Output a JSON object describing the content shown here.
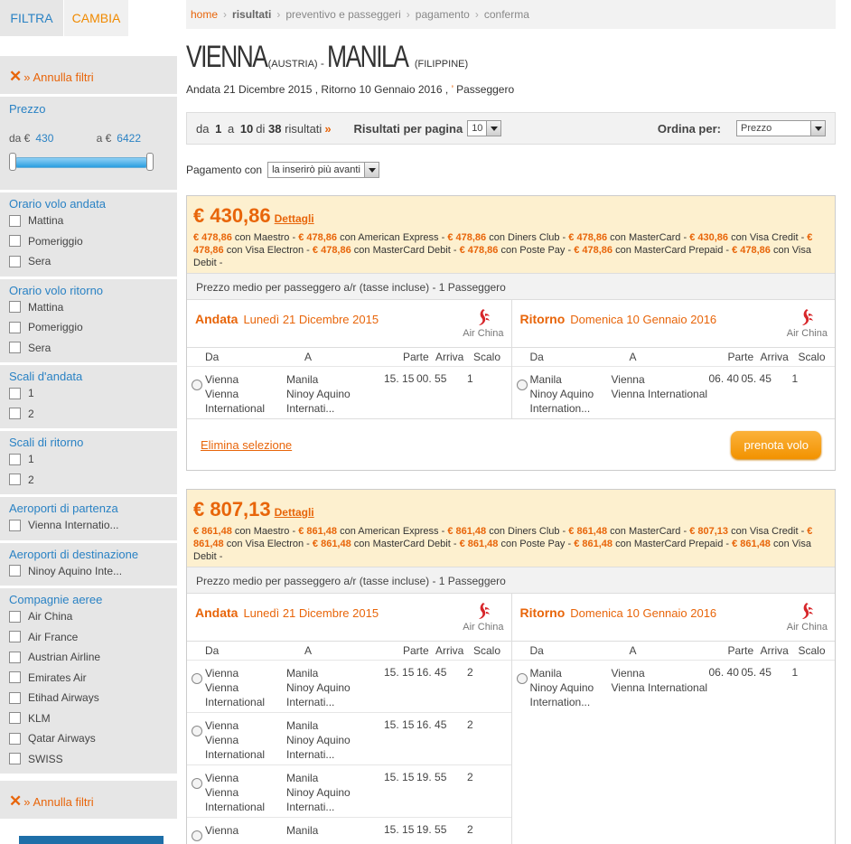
{
  "sidebar": {
    "tabs": {
      "filter": "FILTRA",
      "change": "CAMBIA"
    },
    "reset_label": "Annulla filtri",
    "price": {
      "title": "Prezzo",
      "from_label": "da €",
      "from_value": "430",
      "to_label": "a €",
      "to_value": "6422"
    },
    "outbound_time": {
      "title": "Orario volo andata",
      "options": [
        "Mattina",
        "Pomeriggio",
        "Sera"
      ]
    },
    "return_time": {
      "title": "Orario volo ritorno",
      "options": [
        "Mattina",
        "Pomeriggio",
        "Sera"
      ]
    },
    "outbound_stops": {
      "title": "Scali d'andata",
      "options": [
        "1",
        "2"
      ]
    },
    "return_stops": {
      "title": "Scali di ritorno",
      "options": [
        "1",
        "2"
      ]
    },
    "departure_airports": {
      "title": "Aeroporti di partenza",
      "options": [
        "Vienna Internatio..."
      ]
    },
    "destination_airports": {
      "title": "Aeroporti di destinazione",
      "options": [
        "Ninoy Aquino Inte..."
      ]
    },
    "airlines": {
      "title": "Compagnie aeree",
      "options": [
        "Air China",
        "Air France",
        "Austrian Airline",
        "Emirates Air",
        "Etihad Airways",
        "KLM",
        "Qatar Airways",
        "SWISS"
      ]
    }
  },
  "breadcrumb": {
    "home": "home",
    "current": "risultati",
    "steps": [
      "preventivo e passeggeri",
      "pagamento",
      "conferma"
    ]
  },
  "route": {
    "from_city": "VIENNA",
    "from_country": "(AUSTRIA)",
    "separator": " - ",
    "to_city": "MANILA",
    "to_country": "(FILIPPINE)",
    "dates": "Andata 21 Dicembre 2015 , Ritorno 10 Gennaio 2016 , ",
    "passengers": "Passeggero"
  },
  "pager": {
    "da": "da",
    "from": "1",
    "a": "a",
    "to": "10",
    "di": "di",
    "total": "38",
    "risultati": "risultati",
    "per_page_label": "Risultati per pagina",
    "per_page": "10",
    "sort_label": "Ordina per:",
    "sort_value": "Prezzo"
  },
  "payment": {
    "label": "Pagamento con",
    "value": "la inserirò più avanti"
  },
  "common": {
    "details": "Dettagli",
    "avg": "Prezzo medio per passeggero a/r (tasse incluse) - 1 Passeggero",
    "outbound": "Andata",
    "outbound_date": "Lunedì 21 Dicembre 2015",
    "return": "Ritorno",
    "return_date": "Domenica 10 Gennaio 2016",
    "airline": "Air China",
    "cols": [
      "Da",
      "A",
      "Parte",
      "Arriva",
      "Scalo"
    ],
    "delete": "Elimina selezione",
    "book": "prenota volo"
  },
  "results": [
    {
      "price": "€ 430,86",
      "cards": [
        [
          "€ 478,86",
          "Maestro"
        ],
        [
          "€ 478,86",
          "American Express"
        ],
        [
          "€ 478,86",
          "Diners Club"
        ],
        [
          "€ 478,86",
          "MasterCard"
        ],
        [
          "€ 430,86",
          "Visa Credit"
        ],
        [
          "€ 478,86",
          "Visa Electron"
        ],
        [
          "€ 478,86",
          "MasterCard Debit"
        ],
        [
          "€ 478,86",
          "Poste Pay"
        ],
        [
          "€ 478,86",
          "MasterCard Prepaid"
        ],
        [
          "€ 478,86",
          "Visa Debit"
        ]
      ],
      "outbound": [
        {
          "from1": "Vienna",
          "from2": "Vienna International",
          "to1": "Manila",
          "to2": "Ninoy Aquino",
          "to3": "Internati...",
          "dep": "15. 15",
          "arr": "00. 55",
          "stops": "1"
        }
      ],
      "return": [
        {
          "from1": "Manila",
          "from2": "Ninoy Aquino",
          "from3": "Internation...",
          "to1": "Vienna",
          "to2": "Vienna International",
          "dep": "06. 40",
          "arr": "05. 45",
          "stops": "1"
        }
      ]
    },
    {
      "price": "€ 807,13",
      "cards": [
        [
          "€ 861,48",
          "Maestro"
        ],
        [
          "€ 861,48",
          "American Express"
        ],
        [
          "€ 861,48",
          "Diners Club"
        ],
        [
          "€ 861,48",
          "MasterCard"
        ],
        [
          "€ 807,13",
          "Visa Credit"
        ],
        [
          "€ 861,48",
          "Visa Electron"
        ],
        [
          "€ 861,48",
          "MasterCard Debit"
        ],
        [
          "€ 861,48",
          "Poste Pay"
        ],
        [
          "€ 861,48",
          "MasterCard Prepaid"
        ],
        [
          "€ 861,48",
          "Visa Debit"
        ]
      ],
      "outbound": [
        {
          "from1": "Vienna",
          "from2": "Vienna International",
          "to1": "Manila",
          "to2": "Ninoy Aquino",
          "to3": "Internati...",
          "dep": "15. 15",
          "arr": "16. 45",
          "stops": "2"
        },
        {
          "from1": "Vienna",
          "from2": "Vienna International",
          "to1": "Manila",
          "to2": "Ninoy Aquino",
          "to3": "Internati...",
          "dep": "15. 15",
          "arr": "16. 45",
          "stops": "2"
        },
        {
          "from1": "Vienna",
          "from2": "Vienna International",
          "to1": "Manila",
          "to2": "Ninoy Aquino",
          "to3": "Internati...",
          "dep": "15. 15",
          "arr": "19. 55",
          "stops": "2"
        },
        {
          "from1": "Vienna",
          "from2": "",
          "to1": "Manila",
          "to2": "",
          "to3": "",
          "dep": "15. 15",
          "arr": "19. 55",
          "stops": "2"
        }
      ],
      "return": [
        {
          "from1": "Manila",
          "from2": "Ninoy Aquino",
          "from3": "Internation...",
          "to1": "Vienna",
          "to2": "Vienna International",
          "dep": "06. 40",
          "arr": "05. 45",
          "stops": "1"
        }
      ]
    }
  ],
  "colors": {
    "accent": "#e8650a",
    "link": "#2a82c4",
    "price_bg": "#fdf0cf",
    "button": "#f29200"
  }
}
